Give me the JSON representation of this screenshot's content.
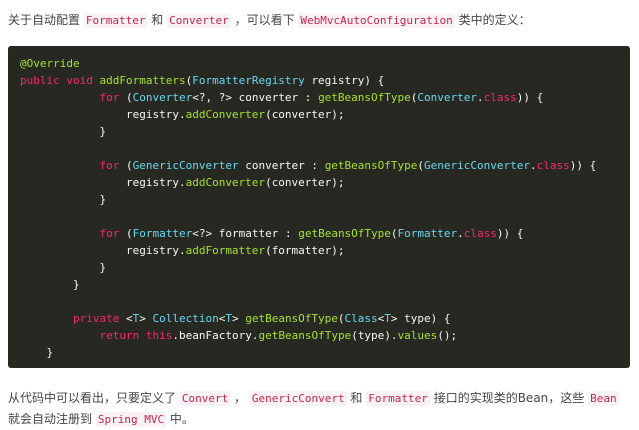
{
  "intro": {
    "prefix": "关于自动配置",
    "formatter": "Formatter",
    "and": "和",
    "converter": "Converter",
    "middle": "，可以看下",
    "config_class": "WebMvcAutoConfiguration",
    "suffix": "类中的定义："
  },
  "code": {
    "lines": [
      "@Override",
      "public void addFormatters(FormatterRegistry registry) {",
      "            for (Converter<?, ?> converter : getBeansOfType(Converter.class)) {",
      "                registry.addConverter(converter);",
      "            }",
      "",
      "            for (GenericConverter converter : getBeansOfType(GenericConverter.class)) {",
      "                registry.addConverter(converter);",
      "            }",
      "",
      "            for (Formatter<?> formatter : getBeansOfType(Formatter.class)) {",
      "                registry.addFormatter(formatter);",
      "            }",
      "        }",
      "",
      "        private <T> Collection<T> getBeansOfType(Class<T> type) {",
      "            return this.beanFactory.getBeansOfType(type).values();",
      "    }"
    ]
  },
  "outro": {
    "prefix": "从代码中可以看出，只要定义了",
    "convert": "Convert",
    "comma1": "，",
    "generic_convert": "GenericConvert",
    "and": "和",
    "formatter": "Formatter",
    "middle": "接口的实现类的Bean，这些",
    "bean": "Bean",
    "middle2": "就会自动注册到",
    "spring_mvc": "Spring MVC",
    "suffix": "中。"
  },
  "colors": {
    "code_background": "#272822",
    "inline_code": "#c7254e",
    "keyword": "#f92672",
    "annotation": "#a6e22e"
  }
}
